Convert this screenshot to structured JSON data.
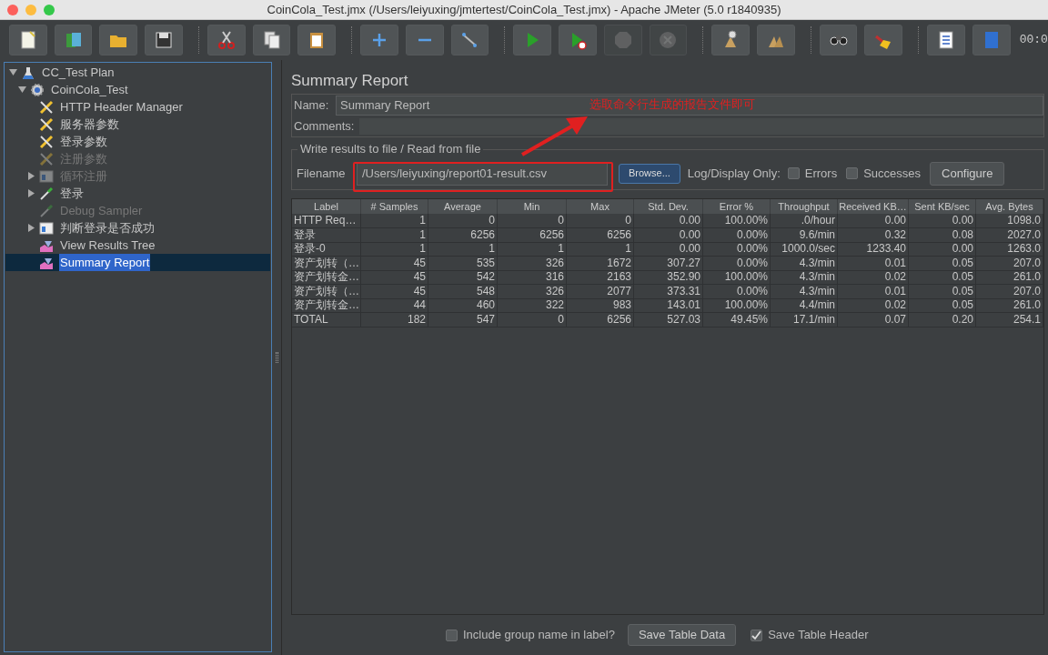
{
  "window": {
    "title": "CoinCola_Test.jmx (/Users/leiyuxing/jmtertest/CoinCola_Test.jmx) - Apache JMeter (5.0 r1840935)"
  },
  "toolbar": {
    "buttons": [
      {
        "disabled": false
      },
      {
        "disabled": false
      },
      {
        "disabled": false
      },
      {
        "disabled": false
      },
      {
        "disabled": false
      },
      {
        "disabled": false
      },
      {
        "disabled": false
      },
      {
        "disabled": false
      },
      {
        "disabled": false
      },
      {
        "disabled": false
      },
      {
        "disabled": false
      },
      {
        "disabled": false
      },
      {
        "disabled": true
      },
      {
        "disabled": true
      },
      {
        "disabled": false
      },
      {
        "disabled": false
      },
      {
        "disabled": false
      },
      {
        "disabled": false
      },
      {
        "disabled": false
      },
      {
        "disabled": false
      }
    ],
    "timer": "00:0"
  },
  "tree": [
    {
      "label": "CC_Test Plan",
      "kind": "plan",
      "expanded": true,
      "disabled": false,
      "selected": false,
      "children": [
        {
          "label": "CoinCola_Test",
          "kind": "threads",
          "expanded": true,
          "disabled": false,
          "selected": false,
          "children": [
            {
              "label": "HTTP Header Manager",
              "kind": "config",
              "disabled": false,
              "selected": false
            },
            {
              "label": "服务器参数",
              "kind": "config",
              "disabled": false,
              "selected": false
            },
            {
              "label": "登录参数",
              "kind": "config",
              "disabled": false,
              "selected": false
            },
            {
              "label": "注册参数",
              "kind": "config",
              "disabled": true,
              "selected": false
            },
            {
              "label": "循环注册",
              "kind": "controller",
              "expanded": false,
              "disabled": true,
              "selected": false
            },
            {
              "label": "登录",
              "kind": "sampler",
              "expanded": false,
              "disabled": false,
              "selected": false
            },
            {
              "label": "Debug Sampler",
              "kind": "sampler",
              "disabled": true,
              "selected": false
            },
            {
              "label": "判断登录是否成功",
              "kind": "controller",
              "expanded": false,
              "disabled": false,
              "selected": false
            },
            {
              "label": "View Results Tree",
              "kind": "listener",
              "disabled": false,
              "selected": false
            },
            {
              "label": "Summary Report",
              "kind": "listener",
              "disabled": false,
              "selected": true
            }
          ]
        }
      ]
    }
  ],
  "panel": {
    "title": "Summary Report",
    "name": {
      "label": "Name:",
      "value": "Summary Report"
    },
    "comments": {
      "label": "Comments:"
    },
    "file_group": {
      "title": "Write results to file / Read from file",
      "filename_label": "Filename",
      "filename": "/Users/leiyuxing/report01-result.csv",
      "browse": "Browse...",
      "log_label": "Log/Display Only:",
      "errors": {
        "label": "Errors",
        "checked": false
      },
      "successes": {
        "label": "Successes",
        "checked": false
      },
      "configure": "Configure"
    },
    "annotation": {
      "text": "选取命令行生成的报告文件即可"
    },
    "table": {
      "columns": [
        "Label",
        "# Samples",
        "Average",
        "Min",
        "Max",
        "Std. Dev.",
        "Error %",
        "Throughput",
        "Received KB…",
        "Sent KB/sec",
        "Avg. Bytes"
      ],
      "rows": [
        [
          "HTTP Req…",
          "1",
          "0",
          "0",
          "0",
          "0.00",
          "100.00%",
          ".0/hour",
          "0.00",
          "0.00",
          "1098.0"
        ],
        [
          "登录",
          "1",
          "6256",
          "6256",
          "6256",
          "0.00",
          "0.00%",
          "9.6/min",
          "0.32",
          "0.08",
          "2027.0"
        ],
        [
          "登录-0",
          "1",
          "1",
          "1",
          "1",
          "0.00",
          "0.00%",
          "1000.0/sec",
          "1233.40",
          "0.00",
          "1263.0"
        ],
        [
          "资产划转（…",
          "45",
          "535",
          "326",
          "1672",
          "307.27",
          "0.00%",
          "4.3/min",
          "0.01",
          "0.05",
          "207.0"
        ],
        [
          "资产划转金…",
          "45",
          "542",
          "316",
          "2163",
          "352.90",
          "100.00%",
          "4.3/min",
          "0.02",
          "0.05",
          "261.0"
        ],
        [
          "资产划转（…",
          "45",
          "548",
          "326",
          "2077",
          "373.31",
          "0.00%",
          "4.3/min",
          "0.01",
          "0.05",
          "207.0"
        ],
        [
          "资产划转金…",
          "44",
          "460",
          "322",
          "983",
          "143.01",
          "100.00%",
          "4.4/min",
          "0.02",
          "0.05",
          "261.0"
        ],
        [
          "TOTAL",
          "182",
          "547",
          "0",
          "6256",
          "527.03",
          "49.45%",
          "17.1/min",
          "0.07",
          "0.20",
          "254.1"
        ]
      ]
    },
    "footer": {
      "include_group": {
        "label": "Include group name in label?",
        "checked": false
      },
      "save_data": "Save Table Data",
      "save_header": {
        "label": "Save Table Header",
        "checked": true
      }
    }
  }
}
